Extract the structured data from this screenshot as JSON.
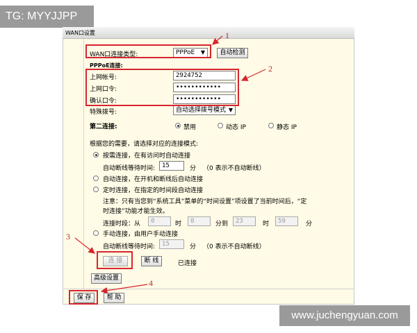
{
  "watermark_tl": "TG: MYYJJPP",
  "watermark_br": "www.juchengyuan.com",
  "panel_title": "WAN口设置",
  "wan_type_label": "WAN口连接类型:",
  "wan_type_value": "PPPoE",
  "auto_detect_label": "自动检测",
  "pppoe_heading": "PPPoE连接:",
  "account_label": "上网帐号:",
  "account_value": "2924752",
  "password_label": "上网口令:",
  "password_value": "••••••••••••",
  "confirm_label": "确认口令:",
  "confirm_value": "••••••••••••",
  "special_dial_label": "特殊拨号:",
  "special_dial_value": "自动选择拨号模式",
  "second_conn_label": "第二连接:",
  "second_options": [
    "禁用",
    "动态 IP",
    "静态 IP"
  ],
  "select_mode_text": "根据您的需要，请选择对应的连接模式:",
  "mode_on_demand": "按需连接，在有访问时自动连接",
  "idle_label": "自动断线等待时间:",
  "idle_value_1": "15",
  "minute_label": "分",
  "zero_note": "（0 表示不自动断线）",
  "mode_auto": "自动连接，在开机和断线后自动连接",
  "mode_timed": "定时连接，在指定的时间段自动连接",
  "timed_note_line1": "注意：只有当您到“系统工具”菜单的“时间设置”项设置了当前时间后，“定",
  "timed_note_line2": "时连接”功能才能生效。",
  "period_label": "连接时段：从",
  "period_from_h": "0",
  "hour_label": "时",
  "period_from_m": "0",
  "minute_to_label": "分到",
  "period_to_h": "23",
  "period_to_m": "59",
  "mode_manual": "手动连接，由用户手动连接",
  "idle_value_2": "15",
  "connect_label": "连 接",
  "disconnect_label": "断 线",
  "status_text": "已连接",
  "advanced_label": "高级设置",
  "save_label": "保 存",
  "help_label": "帮 助",
  "annotations": [
    "1",
    "2",
    "3",
    "4"
  ],
  "annotation_color": "#d6262d"
}
